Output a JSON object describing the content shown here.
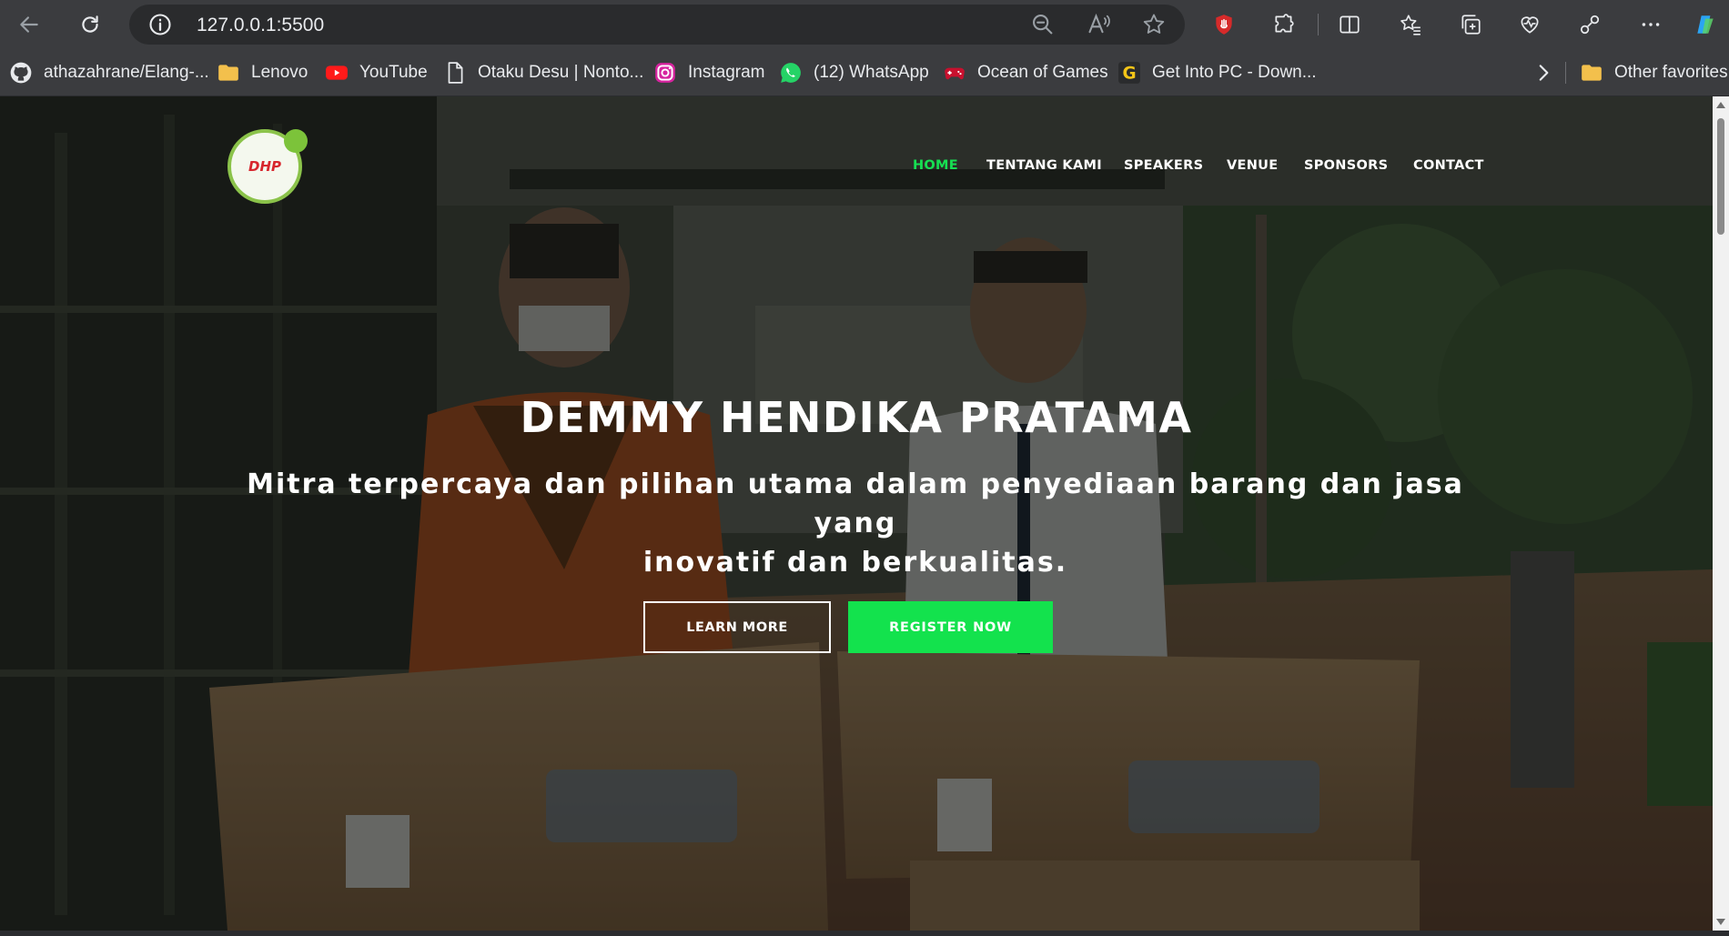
{
  "browser": {
    "url": "127.0.0.1:5500",
    "icons": [
      "back-arrow-icon",
      "reload-icon",
      "info-icon",
      "zoom-out-icon",
      "read-aloud-icon",
      "star-icon",
      "extension-shield-icon",
      "puzzle-icon",
      "split-screen-icon",
      "favorites-icon",
      "collections-icon",
      "health-icon",
      "share-icon",
      "more-icon",
      "copilot-icon"
    ]
  },
  "favorites": [
    {
      "label": "athazahrane/Elang-...",
      "icon": "github-icon"
    },
    {
      "label": "Lenovo",
      "icon": "folder-icon"
    },
    {
      "label": "YouTube",
      "icon": "youtube-icon"
    },
    {
      "label": "Otaku Desu | Nonto...",
      "icon": "page-icon"
    },
    {
      "label": "Instagram",
      "icon": "instagram-icon"
    },
    {
      "label": "(12) WhatsApp",
      "icon": "whatsapp-icon"
    },
    {
      "label": "Ocean of Games",
      "icon": "gamepad-icon"
    },
    {
      "label": "Get Into PC - Down...",
      "icon": "g-icon"
    }
  ],
  "other_favorites": "Other favorites",
  "site": {
    "logo_text": "DHP",
    "nav": {
      "home": "HOME",
      "about": "TENTANG KAMI",
      "speakers": "SPEAKERS",
      "venue": "VENUE",
      "sponsors": "SPONSORS",
      "contact": "CONTACT"
    },
    "hero": {
      "title": "DEMMY HENDIKA PRATAMA",
      "subtitle_line1": "Mitra terpercaya dan pilihan utama dalam penyediaan barang dan jasa yang",
      "subtitle_line2": "inovatif dan berkualitas.",
      "learn_more": "LEARN MORE",
      "register": "REGISTER NOW"
    },
    "colors": {
      "accent": "#13e24d",
      "nav_active": "#16e052",
      "overlay": "#080a08"
    }
  }
}
